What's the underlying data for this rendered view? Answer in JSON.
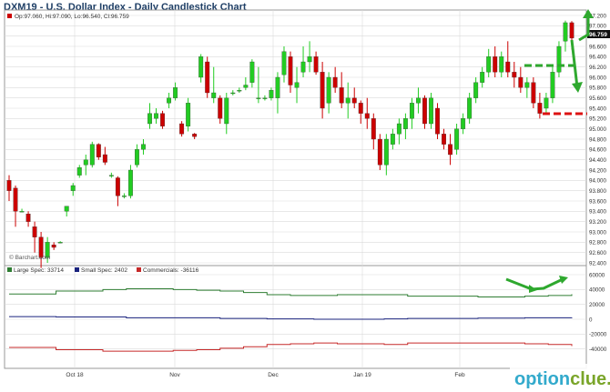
{
  "chart_data": [
    {
      "type": "candlestick",
      "title": "DXM19 - U.S. Dollar Index - Daily Candlestick Chart",
      "ohlc_summary": "Op:97.060, Hi:97.090, Lo:96.540, Cl:96.759",
      "last_price_label": "96.759",
      "copyright": "© Barchart.com",
      "y_range": [
        92.4,
        97.2
      ],
      "y_ticks": [
        "97.200",
        "97.000",
        "96.800",
        "96.600",
        "96.400",
        "96.200",
        "96.000",
        "95.800",
        "95.600",
        "95.400",
        "95.200",
        "95.000",
        "94.800",
        "94.600",
        "94.400",
        "94.200",
        "94.000",
        "93.800",
        "93.600",
        "93.400",
        "93.200",
        "93.000",
        "92.800",
        "92.600",
        "92.400"
      ],
      "x_ticks": [
        "Oct 18",
        "Nov",
        "Dec",
        "Jan 19",
        "Feb"
      ],
      "candles": [
        {
          "o": 94.0,
          "h": 94.1,
          "l": 93.6,
          "c": 93.8
        },
        {
          "o": 93.85,
          "h": 93.9,
          "l": 93.1,
          "c": 93.4
        },
        {
          "o": 93.4,
          "h": 93.45,
          "l": 93.4,
          "c": 93.4
        },
        {
          "o": 93.35,
          "h": 93.4,
          "l": 93.1,
          "c": 93.2
        },
        {
          "o": 93.1,
          "h": 93.2,
          "l": 92.6,
          "c": 92.9
        },
        {
          "o": 92.9,
          "h": 93.0,
          "l": 92.3,
          "c": 92.5
        },
        {
          "o": 92.5,
          "h": 92.9,
          "l": 92.4,
          "c": 92.8
        },
        {
          "o": 92.75,
          "h": 92.8,
          "l": 92.65,
          "c": 92.7
        },
        {
          "o": 92.8,
          "h": 92.82,
          "l": 92.78,
          "c": 92.8
        },
        {
          "o": 93.4,
          "h": 93.5,
          "l": 93.3,
          "c": 93.5
        },
        {
          "o": 93.8,
          "h": 93.95,
          "l": 93.7,
          "c": 93.9
        },
        {
          "o": 94.1,
          "h": 94.3,
          "l": 94.05,
          "c": 94.25
        },
        {
          "o": 94.3,
          "h": 94.5,
          "l": 94.1,
          "c": 94.4
        },
        {
          "o": 94.3,
          "h": 94.75,
          "l": 94.25,
          "c": 94.7
        },
        {
          "o": 94.7,
          "h": 94.72,
          "l": 94.4,
          "c": 94.45
        },
        {
          "o": 94.5,
          "h": 94.65,
          "l": 94.3,
          "c": 94.35
        },
        {
          "o": 94.1,
          "h": 94.15,
          "l": 94.05,
          "c": 94.1
        },
        {
          "o": 94.05,
          "h": 94.08,
          "l": 93.5,
          "c": 93.7
        },
        {
          "o": 93.7,
          "h": 93.75,
          "l": 93.65,
          "c": 93.7
        },
        {
          "o": 93.7,
          "h": 94.3,
          "l": 93.65,
          "c": 94.2
        },
        {
          "o": 94.3,
          "h": 94.7,
          "l": 94.25,
          "c": 94.6
        },
        {
          "o": 94.6,
          "h": 94.8,
          "l": 94.5,
          "c": 94.7
        },
        {
          "o": 95.1,
          "h": 95.5,
          "l": 95.0,
          "c": 95.3
        },
        {
          "o": 95.2,
          "h": 95.4,
          "l": 95.1,
          "c": 95.3
        },
        {
          "o": 95.3,
          "h": 95.35,
          "l": 95.0,
          "c": 95.05
        },
        {
          "o": 95.5,
          "h": 95.7,
          "l": 95.4,
          "c": 95.6
        },
        {
          "o": 95.6,
          "h": 95.9,
          "l": 95.55,
          "c": 95.8
        },
        {
          "o": 95.1,
          "h": 95.15,
          "l": 94.85,
          "c": 94.9
        },
        {
          "o": 95.05,
          "h": 95.6,
          "l": 94.95,
          "c": 95.5
        },
        {
          "o": 94.9,
          "h": 94.92,
          "l": 94.8,
          "c": 94.85
        },
        {
          "o": 96.0,
          "h": 96.45,
          "l": 95.9,
          "c": 96.4
        },
        {
          "o": 96.3,
          "h": 96.4,
          "l": 95.6,
          "c": 95.7
        },
        {
          "o": 95.6,
          "h": 96.2,
          "l": 95.5,
          "c": 95.7
        },
        {
          "o": 95.6,
          "h": 95.65,
          "l": 95.1,
          "c": 95.2
        },
        {
          "o": 95.1,
          "h": 95.7,
          "l": 94.9,
          "c": 95.6
        },
        {
          "o": 95.7,
          "h": 95.75,
          "l": 95.65,
          "c": 95.7
        },
        {
          "o": 95.75,
          "h": 95.8,
          "l": 95.7,
          "c": 95.75
        },
        {
          "o": 95.8,
          "h": 96.0,
          "l": 95.75,
          "c": 95.85
        },
        {
          "o": 95.9,
          "h": 96.35,
          "l": 95.8,
          "c": 96.3
        },
        {
          "o": 95.6,
          "h": 96.2,
          "l": 95.5,
          "c": 95.6
        },
        {
          "o": 95.6,
          "h": 95.65,
          "l": 95.55,
          "c": 95.6
        },
        {
          "o": 95.6,
          "h": 95.8,
          "l": 95.55,
          "c": 95.75
        },
        {
          "o": 95.6,
          "h": 96.1,
          "l": 95.3,
          "c": 96.0
        },
        {
          "o": 96.05,
          "h": 96.6,
          "l": 95.9,
          "c": 96.5
        },
        {
          "o": 96.4,
          "h": 96.5,
          "l": 95.7,
          "c": 95.85
        },
        {
          "o": 95.8,
          "h": 96.2,
          "l": 95.5,
          "c": 95.9
        },
        {
          "o": 96.1,
          "h": 96.6,
          "l": 96.0,
          "c": 96.3
        },
        {
          "o": 96.3,
          "h": 96.7,
          "l": 96.1,
          "c": 96.4
        },
        {
          "o": 96.4,
          "h": 96.5,
          "l": 96.05,
          "c": 96.1
        },
        {
          "o": 96.1,
          "h": 96.3,
          "l": 95.2,
          "c": 95.4
        },
        {
          "o": 95.5,
          "h": 96.1,
          "l": 95.3,
          "c": 96.0
        },
        {
          "o": 96.0,
          "h": 96.2,
          "l": 95.7,
          "c": 95.8
        },
        {
          "o": 95.8,
          "h": 96.1,
          "l": 95.4,
          "c": 95.5
        },
        {
          "o": 95.5,
          "h": 95.9,
          "l": 95.2,
          "c": 95.6
        },
        {
          "o": 95.6,
          "h": 95.8,
          "l": 95.4,
          "c": 95.5
        },
        {
          "o": 95.5,
          "h": 95.55,
          "l": 95.1,
          "c": 95.3
        },
        {
          "o": 95.3,
          "h": 95.6,
          "l": 95.0,
          "c": 95.2
        },
        {
          "o": 95.2,
          "h": 95.3,
          "l": 94.6,
          "c": 94.8
        },
        {
          "o": 94.8,
          "h": 94.9,
          "l": 94.2,
          "c": 94.3
        },
        {
          "o": 94.3,
          "h": 94.9,
          "l": 94.1,
          "c": 94.8
        },
        {
          "o": 94.7,
          "h": 95.0,
          "l": 94.6,
          "c": 94.9
        },
        {
          "o": 94.9,
          "h": 95.2,
          "l": 94.7,
          "c": 95.1
        },
        {
          "o": 95.0,
          "h": 95.3,
          "l": 94.8,
          "c": 95.2
        },
        {
          "o": 95.2,
          "h": 95.6,
          "l": 95.0,
          "c": 95.5
        },
        {
          "o": 95.5,
          "h": 95.8,
          "l": 95.3,
          "c": 95.6
        },
        {
          "o": 95.6,
          "h": 95.65,
          "l": 95.0,
          "c": 95.1
        },
        {
          "o": 95.1,
          "h": 95.7,
          "l": 95.0,
          "c": 95.6
        },
        {
          "o": 95.4,
          "h": 95.5,
          "l": 94.8,
          "c": 94.9
        },
        {
          "o": 94.9,
          "h": 95.0,
          "l": 94.6,
          "c": 94.7
        },
        {
          "o": 94.7,
          "h": 94.9,
          "l": 94.3,
          "c": 94.5
        },
        {
          "o": 94.6,
          "h": 95.1,
          "l": 94.5,
          "c": 95.0
        },
        {
          "o": 95.0,
          "h": 95.3,
          "l": 94.9,
          "c": 95.2
        },
        {
          "o": 95.2,
          "h": 95.7,
          "l": 95.1,
          "c": 95.6
        },
        {
          "o": 95.6,
          "h": 96.0,
          "l": 95.5,
          "c": 95.9
        },
        {
          "o": 95.9,
          "h": 96.2,
          "l": 95.8,
          "c": 96.1
        },
        {
          "o": 96.1,
          "h": 96.55,
          "l": 96.0,
          "c": 96.4
        },
        {
          "o": 96.4,
          "h": 96.6,
          "l": 96.0,
          "c": 96.1
        },
        {
          "o": 96.1,
          "h": 96.5,
          "l": 96.0,
          "c": 96.4
        },
        {
          "o": 96.3,
          "h": 96.7,
          "l": 96.0,
          "c": 96.1
        },
        {
          "o": 96.1,
          "h": 96.3,
          "l": 95.8,
          "c": 96.0
        },
        {
          "o": 96.0,
          "h": 96.2,
          "l": 95.7,
          "c": 95.8
        },
        {
          "o": 95.8,
          "h": 96.0,
          "l": 95.6,
          "c": 95.9
        },
        {
          "o": 95.9,
          "h": 96.0,
          "l": 95.4,
          "c": 95.5
        },
        {
          "o": 95.5,
          "h": 95.7,
          "l": 95.2,
          "c": 95.3
        },
        {
          "o": 95.4,
          "h": 95.7,
          "l": 95.3,
          "c": 95.6
        },
        {
          "o": 95.6,
          "h": 96.2,
          "l": 95.5,
          "c": 96.1
        },
        {
          "o": 96.1,
          "h": 96.7,
          "l": 96.0,
          "c": 96.6
        },
        {
          "o": 96.7,
          "h": 97.1,
          "l": 96.5,
          "c": 97.06
        },
        {
          "o": 97.06,
          "h": 97.09,
          "l": 96.54,
          "c": 96.76
        }
      ],
      "cot_panel": {
        "y_range": [
          -60000,
          60000
        ],
        "y_ticks": [
          "60000",
          "40000",
          "20000",
          "0",
          "-20000",
          "-40000"
        ],
        "legend": [
          {
            "label": "Large Spec: 33714",
            "color": "#2e7d32"
          },
          {
            "label": "Small Spec: 2402",
            "color": "#1a237e"
          },
          {
            "label": "Commercials: -36116",
            "color": "#c62828"
          }
        ],
        "series": [
          {
            "name": "Large Spec",
            "color": "#2e7d32",
            "values": [
              34000,
              34000,
              38000,
              38000,
              40000,
              41000,
              41000,
              40000,
              39000,
              38000,
              36000,
              33000,
              32000,
              32000,
              33000,
              33000,
              33000,
              31000,
              31000,
              31000,
              30000,
              30000,
              31000,
              32000,
              33714
            ]
          },
          {
            "name": "Small Spec",
            "color": "#1a237e",
            "values": [
              3500,
              3500,
              3000,
              3000,
              3000,
              2000,
              2000,
              2000,
              2000,
              1000,
              1000,
              500,
              500,
              0,
              0,
              0,
              500,
              1000,
              1000,
              1000,
              1500,
              1500,
              2000,
              2000,
              2402
            ]
          },
          {
            "name": "Commercials",
            "color": "#c62828",
            "values": [
              -38000,
              -38000,
              -41000,
              -41000,
              -43000,
              -43000,
              -43000,
              -42000,
              -41000,
              -39000,
              -37000,
              -34000,
              -33000,
              -32000,
              -33000,
              -33000,
              -34000,
              -32000,
              -32000,
              -32000,
              -32000,
              -32000,
              -33000,
              -34000,
              -36116
            ]
          }
        ]
      }
    }
  ],
  "watermark": {
    "prefix": "option",
    "suffix": "clue.com"
  },
  "colors": {
    "up": "#22cc22",
    "down": "#cc0000",
    "annotation": "#2ea82e",
    "support": "#dd1111",
    "grid": "#d9d9d9",
    "title": "#1f3f66"
  }
}
